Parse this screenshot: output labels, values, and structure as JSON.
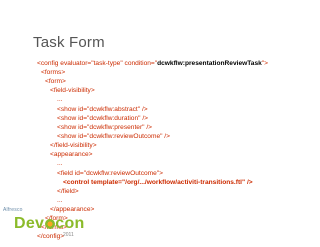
{
  "slide": {
    "title": "Task Form"
  },
  "code": {
    "lines": [
      {
        "pre": "<config evaluator=\"task-type\" condition=\"",
        "hl": "dcwkflw:presentationReviewTask",
        "post": "\">"
      },
      {
        "text": "<forms>"
      },
      {
        "text": "<form>"
      },
      {
        "text": "<field-visibility>"
      },
      {
        "text": "..."
      },
      {
        "text": "<show id=\"dcwkflw:abstract\" />"
      },
      {
        "text": "<show id=\"dcwkflw:duration\" />"
      },
      {
        "text": "<show id=\"dcwkflw:presenter\" />"
      },
      {
        "text": "<show id=\"dcwkflw:reviewOutcome\" />"
      },
      {
        "text": "</field-visibility>"
      },
      {
        "text": "<appearance>"
      },
      {
        "text": "..."
      },
      {
        "text": "<field id=\"dcwkflw:reviewOutcome\">"
      },
      {
        "text": "<control template=\"/org/.../workflow/activiti-transitions.ftl\" />"
      },
      {
        "text": "</field>"
      },
      {
        "text": "..."
      },
      {
        "text": "</appearance>"
      },
      {
        "text": "</form>"
      },
      {
        "text": "</forms>"
      },
      {
        "text": "</config>"
      }
    ]
  },
  "footer": {
    "brand_small": "Alfresco",
    "brand_main_a": "Dev",
    "brand_main_b": "con",
    "year": "2011"
  },
  "colors": {
    "code_text": "#cc2b00",
    "highlight": "#000000",
    "title": "#555555",
    "devcon_green": "#8bbb2a",
    "devcon_orange": "#f6a623"
  }
}
